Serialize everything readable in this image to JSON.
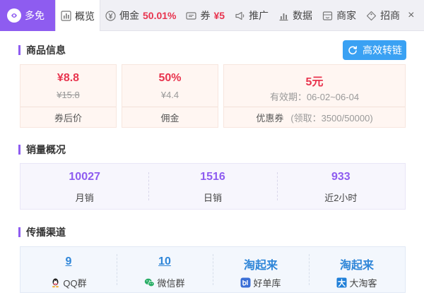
{
  "tabs": {
    "brand": "多免",
    "overview": "概览",
    "commission_label": "佣金",
    "commission_value": "50.01%",
    "coupon_label": "券",
    "coupon_value": "¥5",
    "promote": "推广",
    "data": "数据",
    "merchant": "商家",
    "recruit": "招商",
    "close": "×"
  },
  "goods": {
    "title": "商品信息",
    "convert_button": "高效转链",
    "after_coupon_price": "¥8.8",
    "original_price": "¥15.8",
    "after_coupon_label": "券后价",
    "commission_rate": "50%",
    "commission_amount": "¥4.4",
    "commission_label": "佣金",
    "coupon_amount": "5元",
    "coupon_validity": "有效期：06-02~06-04",
    "coupon_label": "优惠券",
    "coupon_claimed": "(领取：3500/50000)"
  },
  "sales": {
    "title": "销量概况",
    "items": [
      {
        "value": "10027",
        "label": "月销"
      },
      {
        "value": "1516",
        "label": "日销"
      },
      {
        "value": "933",
        "label": "近2小时"
      }
    ]
  },
  "channels": {
    "title": "传播渠道",
    "items": [
      {
        "value": "9",
        "label": "QQ群",
        "icon": "qq-icon"
      },
      {
        "value": "10",
        "label": "微信群",
        "icon": "wechat-icon"
      },
      {
        "value": "淘起来",
        "label": "好单库",
        "icon": "haodanku-icon"
      },
      {
        "value": "淘起来",
        "label": "大淘客",
        "icon": "dataoke-icon"
      }
    ]
  },
  "colors": {
    "brand_purple": "#8e5cf0",
    "price_red": "#e8344e",
    "button_blue": "#3aa1f3",
    "channel_blue": "#2f86d8"
  }
}
